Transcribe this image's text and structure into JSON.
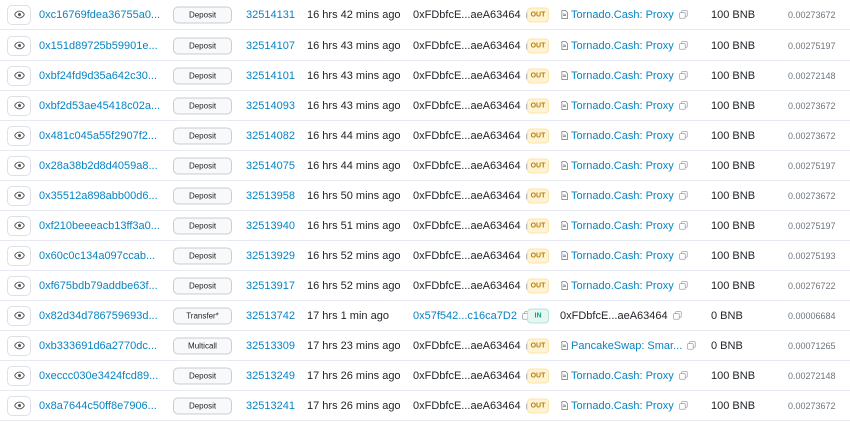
{
  "transactions": [
    {
      "hash": "0xc16769fdea36755a0...",
      "method": "Deposit",
      "block": "32514131",
      "age": "16 hrs 42 mins ago",
      "from": "0xFDbfcE...aeA63464",
      "direction": "OUT",
      "to": "Tornado.Cash: Proxy",
      "value": "100 BNB",
      "fee": "0.00273672"
    },
    {
      "hash": "0x151d89725b59901e...",
      "method": "Deposit",
      "block": "32514107",
      "age": "16 hrs 43 mins ago",
      "from": "0xFDbfcE...aeA63464",
      "direction": "OUT",
      "to": "Tornado.Cash: Proxy",
      "value": "100 BNB",
      "fee": "0.00275197"
    },
    {
      "hash": "0xbf24fd9d35a642c30...",
      "method": "Deposit",
      "block": "32514101",
      "age": "16 hrs 43 mins ago",
      "from": "0xFDbfcE...aeA63464",
      "direction": "OUT",
      "to": "Tornado.Cash: Proxy",
      "value": "100 BNB",
      "fee": "0.00272148"
    },
    {
      "hash": "0xbf2d53ae45418c02a...",
      "method": "Deposit",
      "block": "32514093",
      "age": "16 hrs 43 mins ago",
      "from": "0xFDbfcE...aeA63464",
      "direction": "OUT",
      "to": "Tornado.Cash: Proxy",
      "value": "100 BNB",
      "fee": "0.00273672"
    },
    {
      "hash": "0x481c045a55f2907f2...",
      "method": "Deposit",
      "block": "32514082",
      "age": "16 hrs 44 mins ago",
      "from": "0xFDbfcE...aeA63464",
      "direction": "OUT",
      "to": "Tornado.Cash: Proxy",
      "value": "100 BNB",
      "fee": "0.00273672"
    },
    {
      "hash": "0x28a38b2d8d4059a8...",
      "method": "Deposit",
      "block": "32514075",
      "age": "16 hrs 44 mins ago",
      "from": "0xFDbfcE...aeA63464",
      "direction": "OUT",
      "to": "Tornado.Cash: Proxy",
      "value": "100 BNB",
      "fee": "0.00275197"
    },
    {
      "hash": "0x35512a898abb00d6...",
      "method": "Deposit",
      "block": "32513958",
      "age": "16 hrs 50 mins ago",
      "from": "0xFDbfcE...aeA63464",
      "direction": "OUT",
      "to": "Tornado.Cash: Proxy",
      "value": "100 BNB",
      "fee": "0.00273672"
    },
    {
      "hash": "0xf210beeeacb13ff3a0...",
      "method": "Deposit",
      "block": "32513940",
      "age": "16 hrs 51 mins ago",
      "from": "0xFDbfcE...aeA63464",
      "direction": "OUT",
      "to": "Tornado.Cash: Proxy",
      "value": "100 BNB",
      "fee": "0.00275197"
    },
    {
      "hash": "0x60c0c134a097ccab...",
      "method": "Deposit",
      "block": "32513929",
      "age": "16 hrs 52 mins ago",
      "from": "0xFDbfcE...aeA63464",
      "direction": "OUT",
      "to": "Tornado.Cash: Proxy",
      "value": "100 BNB",
      "fee": "0.00275193"
    },
    {
      "hash": "0xf675bdb79addbe63f...",
      "method": "Deposit",
      "block": "32513917",
      "age": "16 hrs 52 mins ago",
      "from": "0xFDbfcE...aeA63464",
      "direction": "OUT",
      "to": "Tornado.Cash: Proxy",
      "value": "100 BNB",
      "fee": "0.00276722"
    },
    {
      "hash": "0x82d34d786759693d...",
      "method": "Transfer*",
      "block": "32513742",
      "age": "17 hrs 1 min ago",
      "from": "0x57f542...c16ca7D2",
      "direction": "IN",
      "to": "0xFDbfcE...aeA63464",
      "value": "0 BNB",
      "fee": "0.00006684"
    },
    {
      "hash": "0xb333691d6a2770dc...",
      "method": "Multicall",
      "block": "32513309",
      "age": "17 hrs 23 mins ago",
      "from": "0xFDbfcE...aeA63464",
      "direction": "OUT",
      "to": "PancakeSwap: Smar...",
      "value": "0 BNB",
      "fee": "0.00071265"
    },
    {
      "hash": "0xeccc030e3424fcd89...",
      "method": "Deposit",
      "block": "32513249",
      "age": "17 hrs 26 mins ago",
      "from": "0xFDbfcE...aeA63464",
      "direction": "OUT",
      "to": "Tornado.Cash: Proxy",
      "value": "100 BNB",
      "fee": "0.00272148"
    },
    {
      "hash": "0x8a7644c50ff8e7906...",
      "method": "Deposit",
      "block": "32513241",
      "age": "17 hrs 26 mins ago",
      "from": "0xFDbfcE...aeA63464",
      "direction": "OUT",
      "to": "Tornado.Cash: Proxy",
      "value": "100 BNB",
      "fee": "0.00273672"
    }
  ],
  "colors": {
    "link": "#0784c3",
    "out_badge": "#fff3d6",
    "in_badge": "#e6f7f1",
    "border": "#e7eaf3"
  },
  "icons": {
    "view": "eye-icon",
    "copy": "copy-icon",
    "contract": "file-text-icon"
  }
}
